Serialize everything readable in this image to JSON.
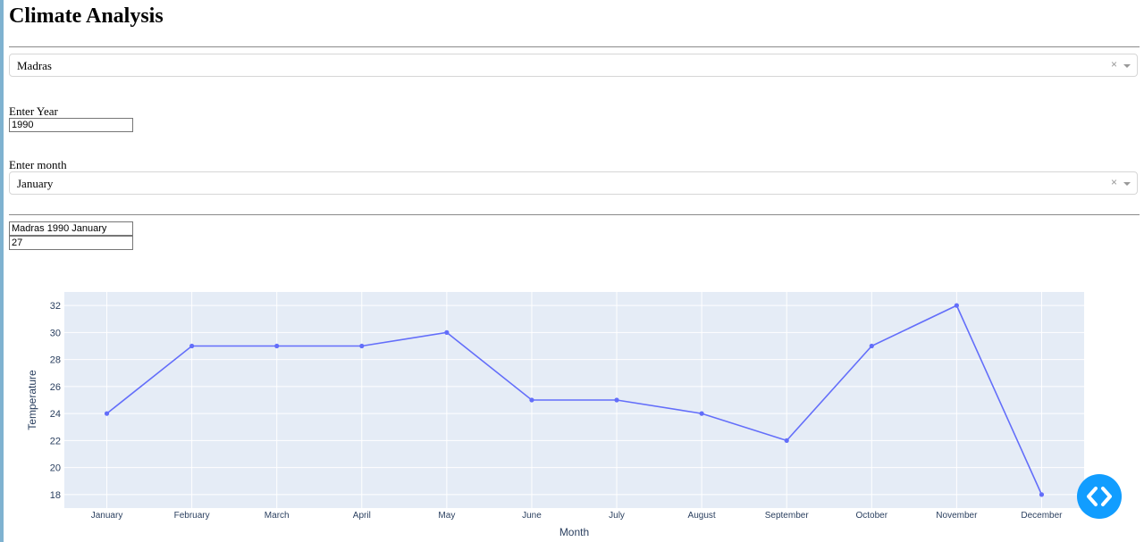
{
  "app": {
    "title": "Climate Analysis"
  },
  "city_select": {
    "value": "Madras",
    "clear": "×"
  },
  "year": {
    "label": "Enter Year",
    "value": "1990"
  },
  "month_select": {
    "label": "Enter month",
    "value": "January",
    "clear": "×"
  },
  "result": {
    "line1": "Madras 1990 January",
    "line2": "27"
  },
  "chart_data": {
    "type": "line",
    "xlabel": "Month",
    "ylabel": "Temperature",
    "categories": [
      "January",
      "February",
      "March",
      "April",
      "May",
      "June",
      "July",
      "August",
      "September",
      "October",
      "November",
      "December"
    ],
    "series": [
      {
        "values": [
          24,
          29,
          29,
          29,
          30,
          25,
          25,
          24,
          22,
          29,
          32,
          18
        ]
      }
    ],
    "ylim": [
      17,
      33
    ],
    "yticks": [
      18,
      20,
      22,
      24,
      26,
      28,
      30,
      32
    ],
    "grid": true,
    "line_color": "#636efa",
    "bg_color": "#e5ecf6"
  },
  "dev_tools": {
    "icon": "code-icon"
  }
}
